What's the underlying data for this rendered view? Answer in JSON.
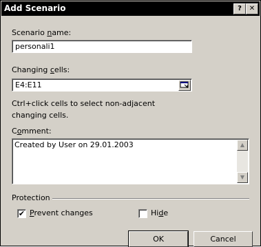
{
  "window": {
    "title": "Add Scenario",
    "help_label": "?",
    "close_label": "✕"
  },
  "scenario_name": {
    "label_before": "Scenario ",
    "label_access": "n",
    "label_after": "ame:",
    "value": "personali1"
  },
  "changing_cells": {
    "label_before": "Changing ",
    "label_access": "c",
    "label_after": "ells:",
    "value": "E4:E11"
  },
  "hint": {
    "line1": "Ctrl+click cells to select non-adjacent",
    "line2": "changing cells."
  },
  "comment": {
    "label_before": "C",
    "label_access": "o",
    "label_after": "mment:",
    "value": "Created by User on 29.01.2003"
  },
  "protection": {
    "group_label": "Protection",
    "prevent_changes": {
      "label_access": "P",
      "label_after": "revent changes",
      "checked": true
    },
    "hide": {
      "label_before": "Hi",
      "label_access": "d",
      "label_after": "e",
      "checked": false
    }
  },
  "buttons": {
    "ok": "OK",
    "cancel": "Cancel"
  }
}
